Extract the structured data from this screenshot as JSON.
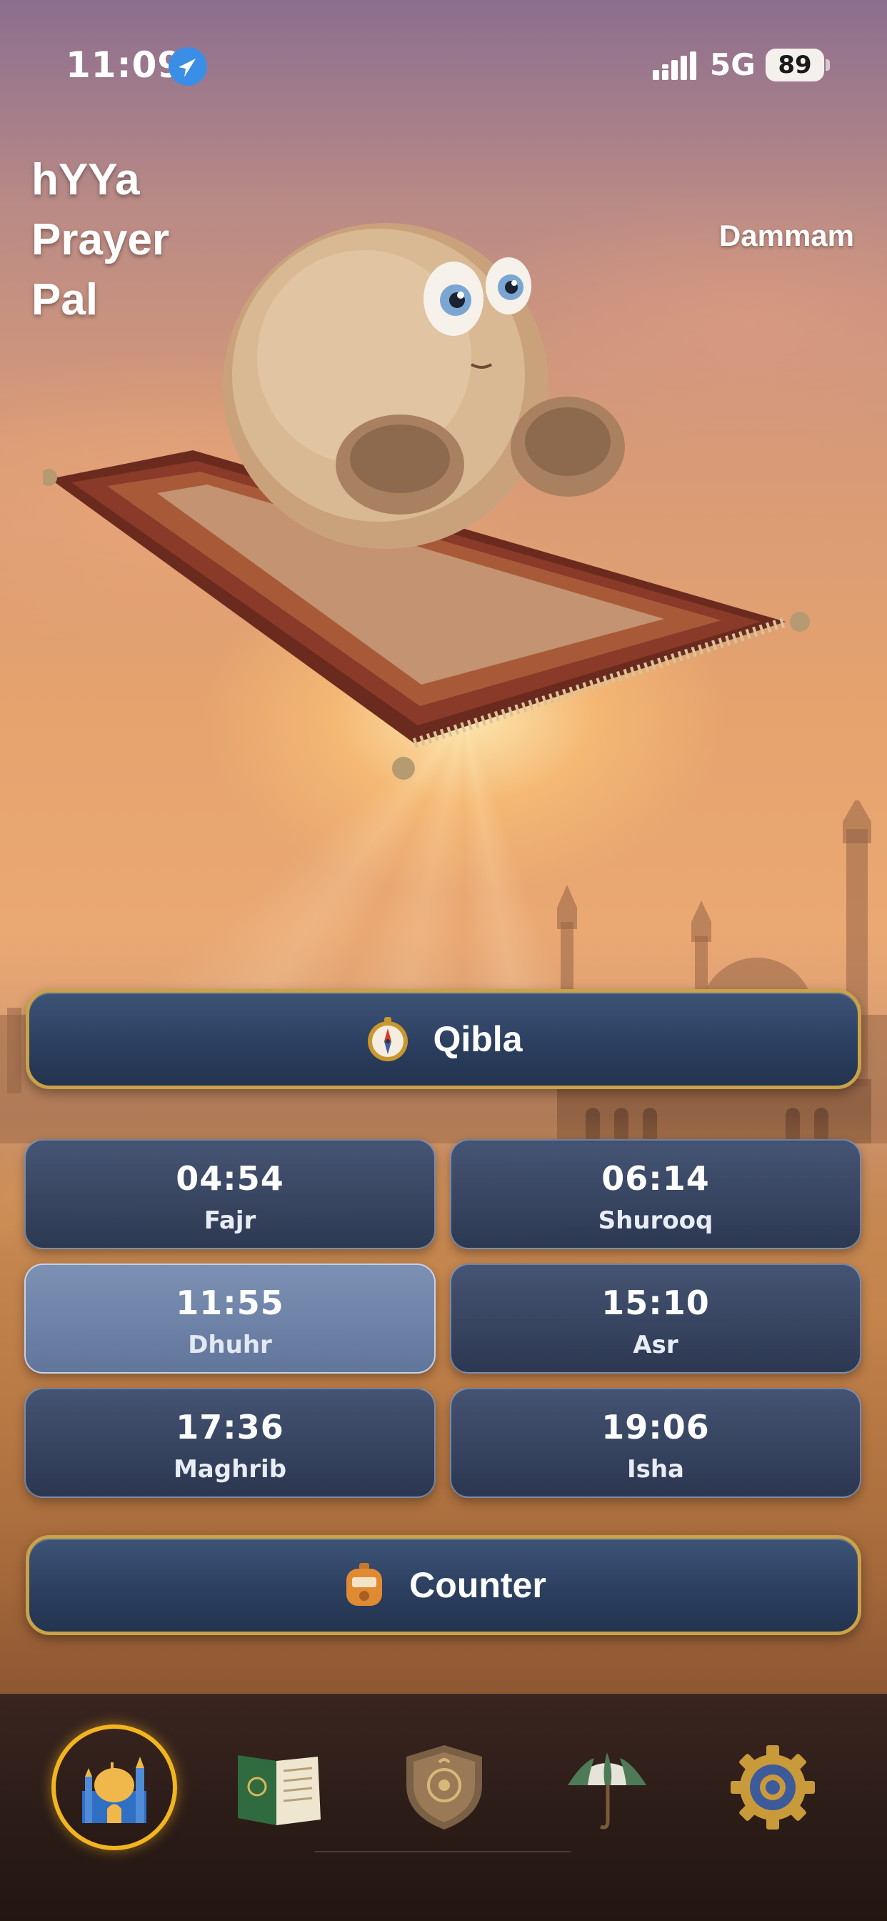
{
  "status_bar": {
    "time": "11:09",
    "network": "5G",
    "battery": "89",
    "location_icon": "location-arrow-icon",
    "signal_icon": "signal-bars-icon"
  },
  "header": {
    "title_lines": [
      "hYYa",
      "Prayer",
      "Pal"
    ],
    "city": "Dammam"
  },
  "actions": {
    "qibla": {
      "label": "Qibla",
      "icon": "compass-icon"
    },
    "counter": {
      "label": "Counter",
      "icon": "tally-counter-icon"
    }
  },
  "prayers": [
    {
      "time": "04:54",
      "name": "Fajr"
    },
    {
      "time": "06:14",
      "name": "Shurooq"
    },
    {
      "time": "11:55",
      "name": "Dhuhr",
      "current": true
    },
    {
      "time": "15:10",
      "name": "Asr"
    },
    {
      "time": "17:36",
      "name": "Maghrib"
    },
    {
      "time": "19:06",
      "name": "Isha"
    }
  ],
  "tabs": [
    {
      "icon": "mosque-icon",
      "selected": true
    },
    {
      "icon": "quran-book-icon"
    },
    {
      "icon": "shield-emblem-icon"
    },
    {
      "icon": "umbrella-icon"
    },
    {
      "icon": "gear-icon"
    }
  ],
  "colors": {
    "accent_gold": "#c9a24a",
    "tab_selected_ring": "#f2b51f",
    "card_blue": "#2c3f60"
  }
}
